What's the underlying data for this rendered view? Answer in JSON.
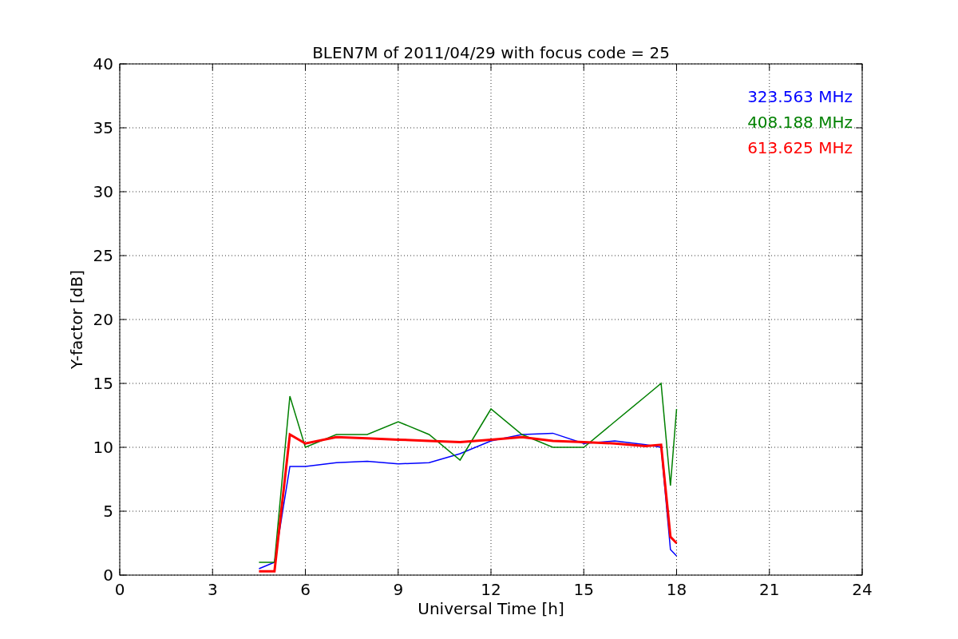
{
  "chart_data": {
    "type": "line",
    "title": "BLEN7M of 2011/04/29 with focus code = 25",
    "xlabel": "Universal Time [h]",
    "ylabel": "Y-factor [dB]",
    "x": [
      4.5,
      5,
      5.5,
      6,
      7,
      8,
      9,
      10,
      11,
      12,
      13,
      14,
      15,
      16,
      17,
      17.5,
      17.8,
      18
    ],
    "series": [
      {
        "name": "323.563 MHz",
        "color": "#0000ff",
        "values": [
          0.5,
          1,
          8.5,
          8.5,
          8.8,
          8.9,
          8.7,
          8.8,
          9.5,
          10.5,
          11,
          11.1,
          10.3,
          10.5,
          10.2,
          10,
          2,
          1.5
        ]
      },
      {
        "name": "408.188 MHz",
        "color": "#008000",
        "values": [
          1,
          1,
          14,
          10,
          11,
          11,
          12,
          11,
          9,
          13,
          11,
          10,
          10,
          12,
          14,
          15,
          7,
          13
        ]
      },
      {
        "name": "613.625 MHz",
        "color": "#ff0000",
        "values": [
          0.3,
          0.3,
          11,
          10.3,
          10.8,
          10.7,
          10.6,
          10.5,
          10.4,
          10.6,
          10.8,
          10.5,
          10.4,
          10.3,
          10.1,
          10.2,
          3,
          2.5
        ]
      }
    ],
    "xlim": [
      0,
      24
    ],
    "ylim": [
      0,
      40
    ],
    "xticks": [
      0,
      3,
      6,
      9,
      12,
      15,
      18,
      21,
      24
    ],
    "yticks": [
      0,
      5,
      10,
      15,
      20,
      25,
      30,
      35,
      40
    ],
    "grid": true
  }
}
